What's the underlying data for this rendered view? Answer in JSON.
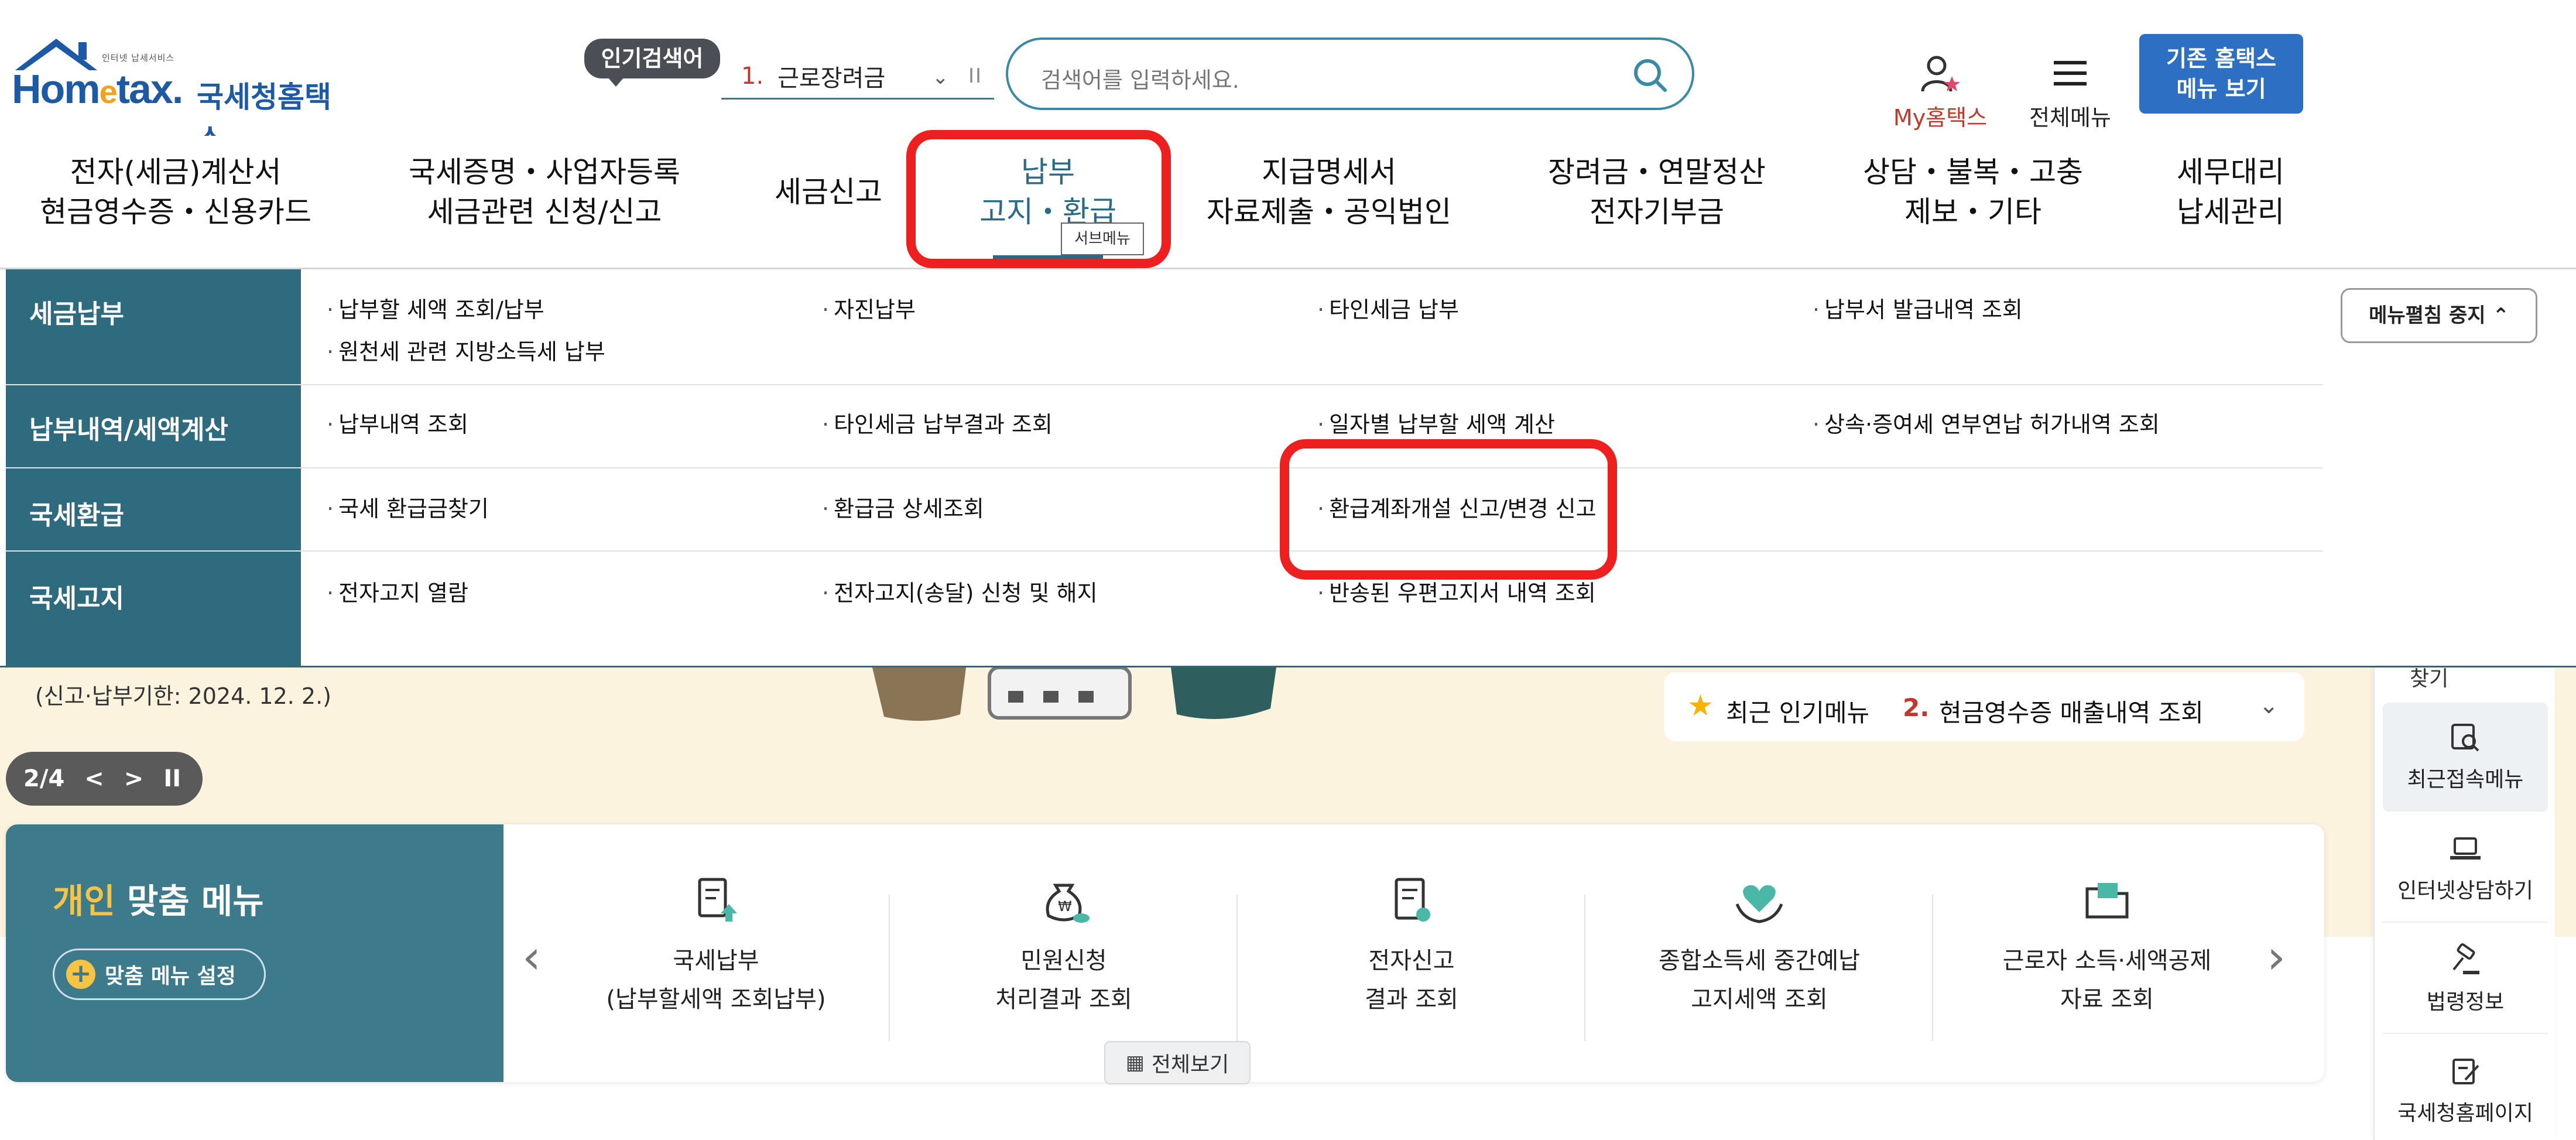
{
  "header": {
    "logo_tagline": "인터넷 납세서비스",
    "logo_brand_a": "Hom",
    "logo_brand_e": "e",
    "logo_brand_b": "tax.",
    "logo_brand_ko": "국세청홈택스",
    "popular_badge": "인기검색어",
    "popular_rank": "1.",
    "popular_term": "근로장려금",
    "popular_pause": "II",
    "search_placeholder": "검색어를 입력하세요.",
    "mytax_label": "My홈택스",
    "allmenu_label": "전체메뉴",
    "old_hometax_line1": "기존 홈택스",
    "old_hometax_line2": "메뉴 보기"
  },
  "nav": {
    "items": [
      {
        "line1": "전자(세금)계산서",
        "line2": "현금영수증・신용카드"
      },
      {
        "line1": "국세증명・사업자등록",
        "line2": "세금관련 신청/신고"
      },
      {
        "line1": "세금신고",
        "line2": ""
      },
      {
        "line1": "납부",
        "line2": "고지・환급"
      },
      {
        "line1": "지급명세서",
        "line2": "자료제출・공익법인"
      },
      {
        "line1": "장려금・연말정산",
        "line2": "전자기부금"
      },
      {
        "line1": "상담・불복・고충",
        "line2": "제보・기타"
      },
      {
        "line1": "세무대리",
        "line2": "납세관리"
      }
    ],
    "submenu_tooltip": "서브메뉴",
    "active_color": "#2a6a86"
  },
  "mega_menu": {
    "stop_button": "메뉴펼침 중지",
    "rows": [
      {
        "category": "세금납부",
        "links": [
          "납부할 세액 조회/납부",
          "자진납부",
          "타인세금 납부",
          "납부서 발급내역 조회",
          "원천세 관련 지방소득세 납부"
        ]
      },
      {
        "category": "납부내역/세액계산",
        "links": [
          "납부내역 조회",
          "타인세금 납부결과 조회",
          "일자별 납부할 세액 계산",
          "상속·증여세 연부연납 허가내역 조회"
        ]
      },
      {
        "category": "국세환급",
        "links": [
          "국세 환급금찾기",
          "환급금 상세조회",
          "환급계좌개설 신고/변경 신고"
        ]
      },
      {
        "category": "국세고지",
        "links": [
          "전자고지 열람",
          "전자고지(송달) 신청 및 해지",
          "반송된 우편고지서 내역 조회"
        ]
      }
    ]
  },
  "banner": {
    "note": "(신고·납부기한: 2024. 12. 2.)",
    "pager_text": "2/4",
    "pager_prev": "<",
    "pager_next": ">",
    "pager_pause": "II",
    "recent_popular_label": "최근 인기메뉴",
    "recent_popular_rank": "2.",
    "recent_popular_item": "현금영수증 매출내역 조회"
  },
  "custom_menu": {
    "title_highlight": "개인",
    "title_rest": "맞춤 메뉴",
    "settings_button": "맞춤 메뉴 설정",
    "items": [
      {
        "line1": "국세납부",
        "line2": "(납부할세액 조회납부)",
        "icon": "document-upload-icon"
      },
      {
        "line1": "민원신청",
        "line2": "처리결과 조회",
        "icon": "money-bag-icon"
      },
      {
        "line1": "전자신고",
        "line2": "결과 조회",
        "icon": "certificate-icon"
      },
      {
        "line1": "종합소득세 중간예납",
        "line2": "고지세액 조회",
        "icon": "heart-hands-icon"
      },
      {
        "line1": "근로자 소득·세액공제",
        "line2": "자료 조회",
        "icon": "folder-icon"
      }
    ],
    "view_all": "전체보기"
  },
  "quick_menu": {
    "cut_label": "찾기",
    "items": [
      {
        "label": "최근접속메뉴",
        "icon": "recent-search-icon"
      },
      {
        "label": "인터넷상담하기",
        "icon": "laptop-icon"
      },
      {
        "label": "법령정보",
        "icon": "gavel-icon"
      },
      {
        "label": "국세청홈페이지",
        "icon": "edit-document-icon"
      }
    ]
  },
  "colors": {
    "brand_blue": "#1d5aa6",
    "teal": "#2e6b7e",
    "highlight_red": "#ee1f1f",
    "banner_bg": "#fcf3df"
  }
}
